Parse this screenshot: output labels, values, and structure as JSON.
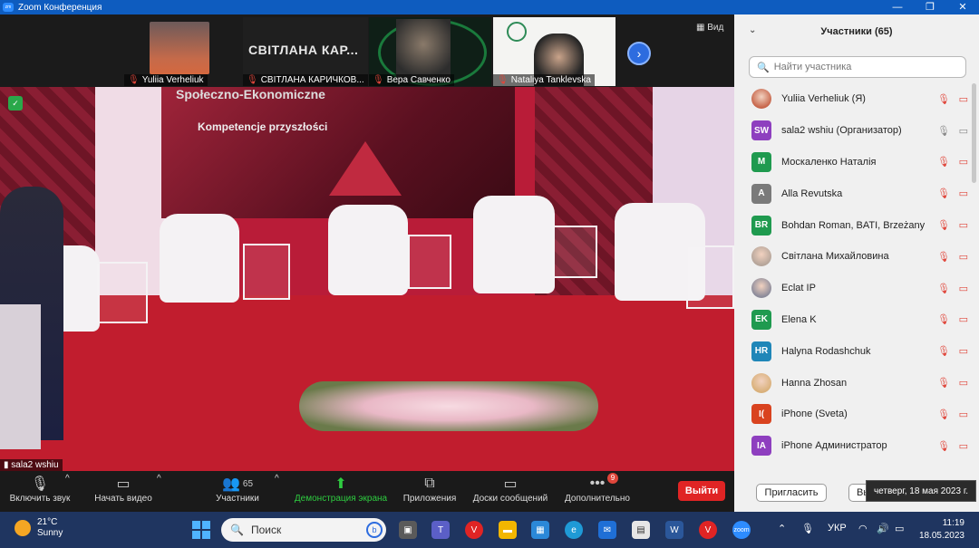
{
  "window": {
    "title": "Zoom Конференция",
    "controls": [
      "—",
      "❐",
      "✕"
    ]
  },
  "gallery": {
    "view_label": "Вид",
    "tiles": [
      {
        "name": "Yuliia Verheliuk"
      },
      {
        "name": "СВІТЛАНА КАРИЧКОВ...",
        "big_name": "СВІТЛАНА КАР..."
      },
      {
        "name": "Вера Савченко"
      },
      {
        "name": "Nataliya Tanklevska"
      }
    ]
  },
  "main_video": {
    "caption": "sala2 wshiu",
    "screen_line1": "Społeczno-Ekonomiczne",
    "screen_line2": "Kompetencje przyszłości"
  },
  "toolbar": {
    "mute_label": "Включить звук",
    "video_label": "Начать видео",
    "participants_label": "Участники",
    "participants_count": "65",
    "share_label": "Демонстрация экрана",
    "apps_label": "Приложения",
    "whiteboard_label": "Доски сообщений",
    "more_label": "Дополнительно",
    "more_badge": "9",
    "leave_label": "Выйти"
  },
  "participants_panel": {
    "title": "Участники (65)",
    "search_placeholder": "Найти участника",
    "invite_label": "Пригласить",
    "other_label": "Вы",
    "participants": [
      {
        "name": "Yuliia Verheliuk (Я)",
        "initials": "",
        "color": "#c7654a",
        "photo": true
      },
      {
        "name": "sala2 wshiu (Организатор)",
        "initials": "SW",
        "color": "#8e3fbf",
        "photo": false
      },
      {
        "name": " Москаленко Наталія",
        "initials": "M",
        "color": "#1f9a4f",
        "photo": false
      },
      {
        "name": "Alla Revutska",
        "initials": "A",
        "color": "#7a7a7a",
        "photo": false
      },
      {
        "name": "Bohdan Roman, BATI, Brzeżany",
        "initials": "BR",
        "color": "#1f9a4f",
        "photo": false
      },
      {
        "name": "Світлана Михайловина",
        "initials": "",
        "color": "#b5a59a",
        "photo": true
      },
      {
        "name": "Eclat IP",
        "initials": "",
        "color": "#8a8a9a",
        "photo": true
      },
      {
        "name": "Elena K",
        "initials": "EK",
        "color": "#1f9a4f",
        "photo": false
      },
      {
        "name": "Halyna Rodashchuk",
        "initials": "HR",
        "color": "#1f86b8",
        "photo": false
      },
      {
        "name": "Hanna Zhosan",
        "initials": "",
        "color": "#d9b07a",
        "photo": true
      },
      {
        "name": "iPhone (Sveta)",
        "initials": "I(",
        "color": "#d9431f",
        "photo": false
      },
      {
        "name": "iPhone Администратор",
        "initials": "IA",
        "color": "#8e3fbf",
        "photo": false
      }
    ]
  },
  "tooltip": {
    "date": "четверг, 18 мая 2023 г."
  },
  "taskbar": {
    "temperature": "21°C",
    "condition": "Sunny",
    "search_placeholder": "Поиск",
    "language": "УКР",
    "time": "11:19",
    "date": "18.05.2023"
  }
}
